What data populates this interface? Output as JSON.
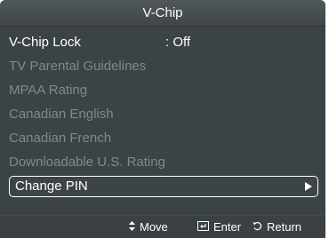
{
  "title": "V-Chip",
  "menu": {
    "vchip_lock_label": "V-Chip Lock",
    "vchip_lock_value": ": Off",
    "tv_parental_guidelines": "TV Parental Guidelines",
    "mpaa_rating": "MPAA Rating",
    "canadian_english": "Canadian English",
    "canadian_french": "Canadian French",
    "downloadable_us_rating": "Downloadable U.S. Rating",
    "change_pin": "Change PIN"
  },
  "footer": {
    "move_icon": "up-down-arrows",
    "move_label": "Move",
    "enter_icon": "enter-key",
    "enter_label": "Enter",
    "return_icon": "return-arrow",
    "return_label": "Return"
  },
  "colors": {
    "panel_bg": "#3c4346",
    "title_bg": "#4a5155",
    "enabled_text": "#ffffff",
    "disabled_text": "#80898c",
    "selection_border": "#ffffff"
  }
}
